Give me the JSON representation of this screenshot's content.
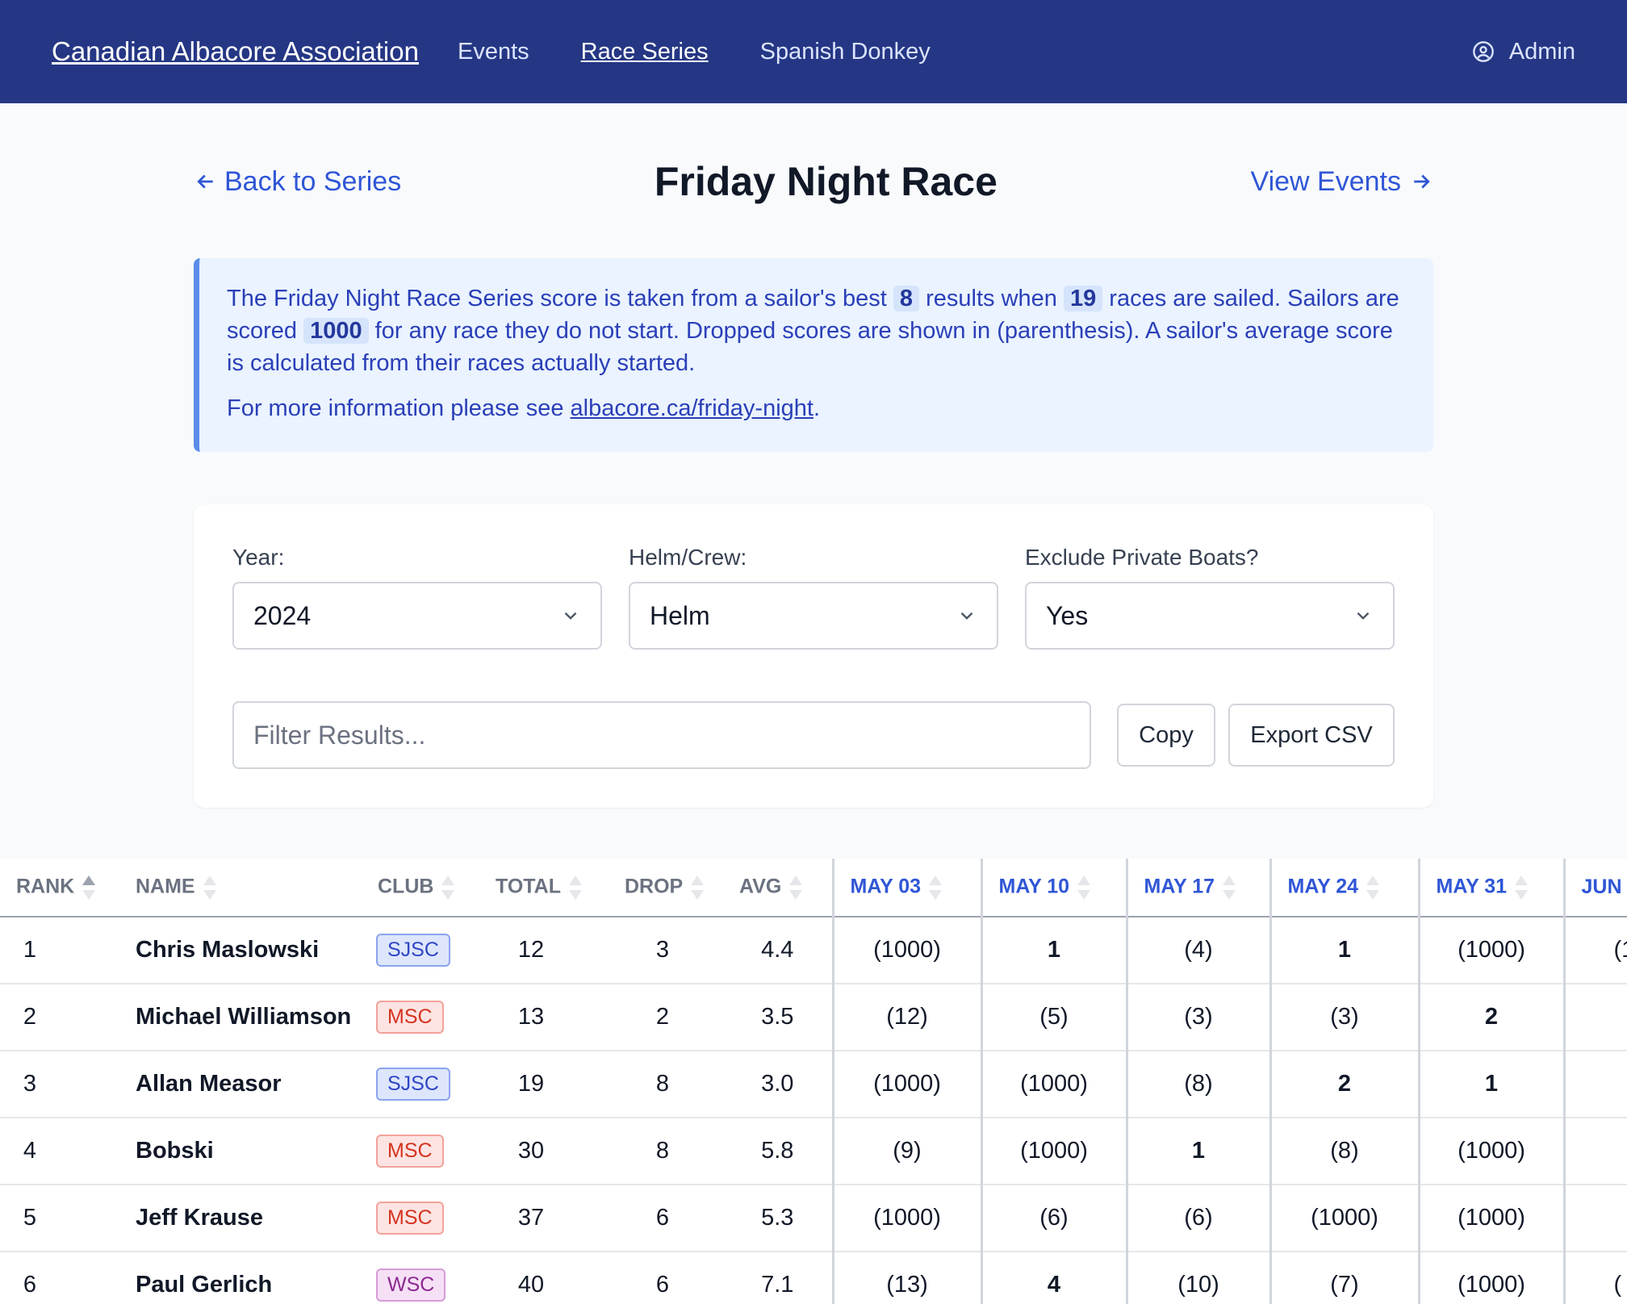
{
  "nav": {
    "brand": "Canadian Albacore Association",
    "links": [
      "Events",
      "Race Series",
      "Spanish Donkey"
    ],
    "active": "Race Series",
    "admin": "Admin"
  },
  "header": {
    "back": "Back to Series",
    "title": "Friday Night Race",
    "view_events": "View Events"
  },
  "info": {
    "t1": "The Friday Night Race Series score is taken from a sailor's best ",
    "best": "8",
    "t2": " results when ",
    "races": "19",
    "t3": " races are sailed. Sailors are scored ",
    "dnf": "1000",
    "t4": " for any race they do not start. Dropped scores are shown in (parenthesis). A sailor's average score is calculated from their races actually started.",
    "more_prefix": "For more information please see ",
    "more_link": "albacore.ca/friday-night",
    "more_suffix": "."
  },
  "filters": {
    "year_label": "Year:",
    "year_value": "2024",
    "helm_label": "Helm/Crew:",
    "helm_value": "Helm",
    "exclude_label": "Exclude Private Boats?",
    "exclude_value": "Yes",
    "filter_placeholder": "Filter Results...",
    "copy": "Copy",
    "export": "Export CSV"
  },
  "table": {
    "headers": {
      "rank": "RANK",
      "name": "NAME",
      "club": "CLUB",
      "total": "TOTAL",
      "drop": "DROP",
      "avg": "AVG",
      "r1": "MAY 03",
      "r2": "MAY 10",
      "r3": "MAY 17",
      "r4": "MAY 24",
      "r5": "MAY 31",
      "r6": "JUN"
    },
    "rows": [
      {
        "rank": "1",
        "name": "Chris Maslowski",
        "club": "SJSC",
        "total": "12",
        "drop": "3",
        "avg": "4.4",
        "r1": "(1000)",
        "r2": "1",
        "r3": "(4)",
        "r4": "1",
        "r5": "(1000)",
        "r6": "(1"
      },
      {
        "rank": "2",
        "name": "Michael Williamson",
        "club": "MSC",
        "total": "13",
        "drop": "2",
        "avg": "3.5",
        "r1": "(12)",
        "r2": "(5)",
        "r3": "(3)",
        "r4": "(3)",
        "r5": "2",
        "r6": ""
      },
      {
        "rank": "3",
        "name": "Allan Measor",
        "club": "SJSC",
        "total": "19",
        "drop": "8",
        "avg": "3.0",
        "r1": "(1000)",
        "r2": "(1000)",
        "r3": "(8)",
        "r4": "2",
        "r5": "1",
        "r6": ""
      },
      {
        "rank": "4",
        "name": "Bobski",
        "club": "MSC",
        "total": "30",
        "drop": "8",
        "avg": "5.8",
        "r1": "(9)",
        "r2": "(1000)",
        "r3": "1",
        "r4": "(8)",
        "r5": "(1000)",
        "r6": ""
      },
      {
        "rank": "5",
        "name": "Jeff Krause",
        "club": "MSC",
        "total": "37",
        "drop": "6",
        "avg": "5.3",
        "r1": "(1000)",
        "r2": "(6)",
        "r3": "(6)",
        "r4": "(1000)",
        "r5": "(1000)",
        "r6": ""
      },
      {
        "rank": "6",
        "name": "Paul Gerlich",
        "club": "WSC",
        "total": "40",
        "drop": "6",
        "avg": "7.1",
        "r1": "(13)",
        "r2": "4",
        "r3": "(10)",
        "r4": "(7)",
        "r5": "(1000)",
        "r6": "("
      }
    ]
  }
}
